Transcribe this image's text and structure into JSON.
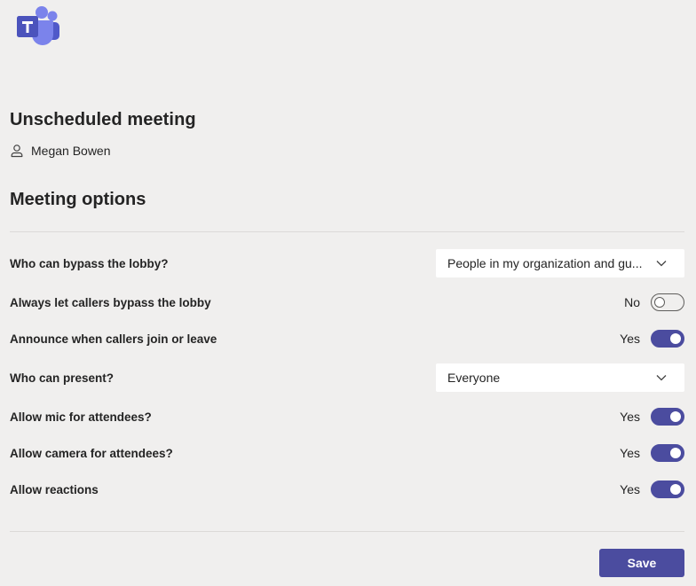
{
  "meeting": {
    "title": "Unscheduled meeting",
    "organizer": "Megan Bowen"
  },
  "options_title": "Meeting options",
  "colors": {
    "accent": "#4b4c9f",
    "background": "#f0efee"
  },
  "options": {
    "bypass_lobby": {
      "label": "Who can bypass the lobby?",
      "value": "People in my organization and gu..."
    },
    "callers_bypass": {
      "label": "Always let callers bypass the lobby",
      "state": "No"
    },
    "announce_callers": {
      "label": "Announce when callers join or leave",
      "state": "Yes"
    },
    "who_present": {
      "label": "Who can present?",
      "value": "Everyone"
    },
    "allow_mic": {
      "label": "Allow mic for attendees?",
      "state": "Yes"
    },
    "allow_camera": {
      "label": "Allow camera for attendees?",
      "state": "Yes"
    },
    "allow_reactions": {
      "label": "Allow reactions",
      "state": "Yes"
    }
  },
  "save_label": "Save",
  "icons": {
    "logo": "teams-logo-icon",
    "person": "person-icon",
    "dropdown": "chevron-down-icon"
  }
}
